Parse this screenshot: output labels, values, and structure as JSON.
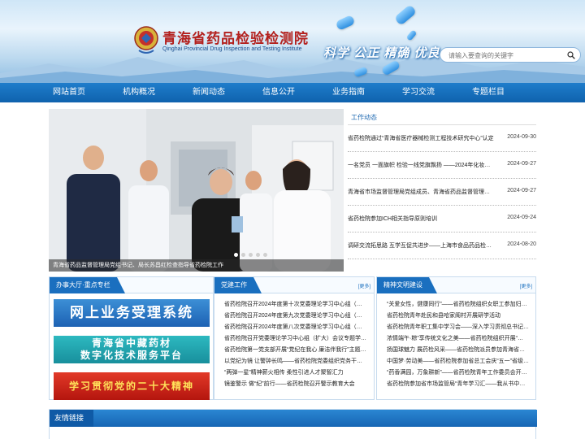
{
  "header": {
    "site_title": "青海省药品检验检测院",
    "site_subtitle": "Qinghai Provincial Drug Inspection and Testing Institute",
    "slogan": "科学 公正 精确 优良",
    "search_placeholder": "请输入要查询的关键字",
    "logo_icon": "institute-seal-icon",
    "search_icon": "magnifier-icon"
  },
  "nav": {
    "items": [
      "网站首页",
      "机构概况",
      "新闻动态",
      "信息公开",
      "业务指南",
      "学习交流",
      "专题栏目"
    ]
  },
  "slideshow": {
    "caption": "青海省药品监督管理局党组书记、局长苏昌红检查指导省药检院工作",
    "slide_count": 5,
    "active_index": 0
  },
  "work_news": {
    "heading": "工作动态",
    "items": [
      {
        "title": "省药检院通过“青海省医疗器械检测工程技术研究中心”认定",
        "date": "2024-09-30"
      },
      {
        "title": "一名党员 一面旗帜 检验一线党旗飘扬 ——2024年化妆品…",
        "date": "2024-09-27"
      },
      {
        "title": "青海省市场监督管理局党组成员、青海省药品监督管理局…",
        "date": "2024-09-27"
      },
      {
        "title": "省药检院参加ICH相关指导原则培训",
        "date": "2024-09-24"
      },
      {
        "title": "调研交流拓思路 互学互促共进步——上海市食品药品检验…",
        "date": "2024-08-20"
      }
    ]
  },
  "service_panel": {
    "heading": "办事大厅·重点专栏",
    "banners": {
      "online": "网上业务受理系统",
      "herb_line1": "青海省中藏药材",
      "herb_line2": "数字化技术服务平台",
      "congress": "学习贯彻党的二十大精神"
    }
  },
  "party_panel": {
    "heading": "党建工作",
    "more": "[更多]",
    "items": [
      "省药检院召开2024年度第十次党委理论学习中心组（…",
      "省药检院召开2024年度第九次党委理论学习中心组（…",
      "省药检院召开2024年度第八次党委理论学习中心组（…",
      "省药检院召开党委理论学习中心组（扩大）会议专题学…",
      "省药检院第一党支部开展“党纪在我心 廉洁伴我行”主题…",
      "以党纪为镜 让警钟长鸣——省药检院党委组织党务干…",
      "“两弹一星”精神薪火相传 柔性引进人才聚智汇力",
      "镜鉴警示 做“纪”前行——省药检院召开警示教育大会"
    ]
  },
  "culture_panel": {
    "heading": "精神文明建设",
    "more": "[更多]",
    "items": [
      "“关爱女性，健康同行”——省药检院组织女职工参加妇…",
      "省药检院青年赴民和县哈家阁村开展研学活动",
      "省药检院青年职工集中学习会——深入学习贯彻总书记…",
      "浓情端午·粽”享传统文化之美——省药检院组织开展“…",
      "扬国球魅力 展药检风采——省药检院派员参加青海省…",
      "中国梦·劳动美——省药检院参加省总工会庆“五一”省级…",
      "“药香满园，万象耕新”——省药检院青年工作委员会开…",
      "省药检院参加省市场监管局“青年学习汇——我从书中…"
    ]
  },
  "links": {
    "heading": "友情链接"
  },
  "colors": {
    "nav_blue": "#1470c0",
    "title_red": "#b3201d",
    "tab_blue": "#1a6fbf"
  }
}
